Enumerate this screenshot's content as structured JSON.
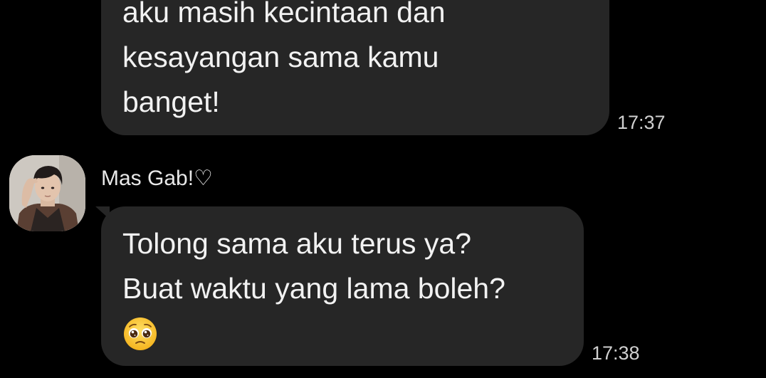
{
  "messages": [
    {
      "direction": "incoming",
      "text": "aku masih kecintaan dan\nkesayangan sama kamu\nbanget!",
      "time": "17:37"
    },
    {
      "direction": "incoming",
      "sender": "Mas Gab!♡",
      "avatar": "profile-photo",
      "text": "Tolong sama aku terus ya?\nBuat waktu yang lama boleh?",
      "emoji": "pleading-face-emoji",
      "time": "17:38"
    }
  ],
  "colors": {
    "background": "#000000",
    "bubble": "#262626",
    "text": "#f2f2f2",
    "timestamp": "#d0d0d0"
  }
}
